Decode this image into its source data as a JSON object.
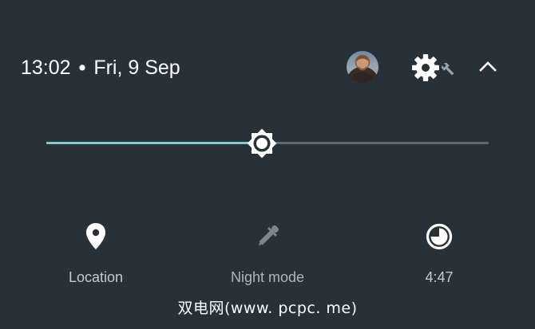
{
  "header": {
    "time": "13:02",
    "separator": "•",
    "date": "Fri, 9 Sep"
  },
  "brightness": {
    "level": 0.487,
    "active_color": "#80cbc4",
    "track_color": "#5f6a70"
  },
  "tiles": [
    {
      "label": "Location",
      "icon": "location-pin-icon",
      "enabled": true
    },
    {
      "label": "Night mode",
      "icon": "eyedropper-icon",
      "enabled": false
    },
    {
      "label": "4:47",
      "icon": "battery-saver-icon",
      "enabled": true
    }
  ],
  "watermark": "双电网(www. pcpc. me)",
  "colors": {
    "background": "#263238",
    "icon": "#ffffff",
    "icon_disabled": "#7d878c",
    "label": "#c5cbce"
  }
}
